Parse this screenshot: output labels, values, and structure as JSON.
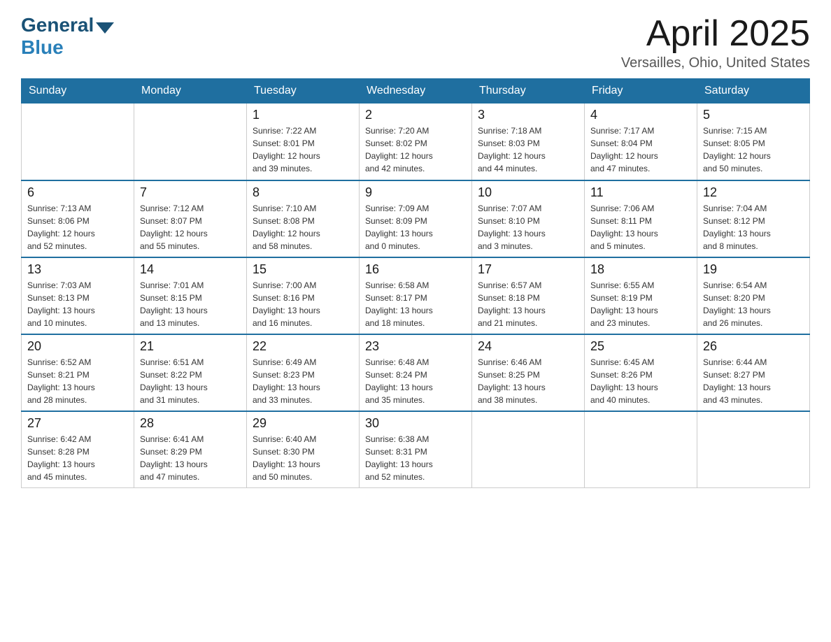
{
  "header": {
    "logo": {
      "general": "General",
      "triangle_symbol": "▶",
      "blue": "Blue"
    },
    "title": "April 2025",
    "location": "Versailles, Ohio, United States"
  },
  "calendar": {
    "days_of_week": [
      "Sunday",
      "Monday",
      "Tuesday",
      "Wednesday",
      "Thursday",
      "Friday",
      "Saturday"
    ],
    "weeks": [
      [
        {
          "day": "",
          "info": ""
        },
        {
          "day": "",
          "info": ""
        },
        {
          "day": "1",
          "info": "Sunrise: 7:22 AM\nSunset: 8:01 PM\nDaylight: 12 hours\nand 39 minutes."
        },
        {
          "day": "2",
          "info": "Sunrise: 7:20 AM\nSunset: 8:02 PM\nDaylight: 12 hours\nand 42 minutes."
        },
        {
          "day": "3",
          "info": "Sunrise: 7:18 AM\nSunset: 8:03 PM\nDaylight: 12 hours\nand 44 minutes."
        },
        {
          "day": "4",
          "info": "Sunrise: 7:17 AM\nSunset: 8:04 PM\nDaylight: 12 hours\nand 47 minutes."
        },
        {
          "day": "5",
          "info": "Sunrise: 7:15 AM\nSunset: 8:05 PM\nDaylight: 12 hours\nand 50 minutes."
        }
      ],
      [
        {
          "day": "6",
          "info": "Sunrise: 7:13 AM\nSunset: 8:06 PM\nDaylight: 12 hours\nand 52 minutes."
        },
        {
          "day": "7",
          "info": "Sunrise: 7:12 AM\nSunset: 8:07 PM\nDaylight: 12 hours\nand 55 minutes."
        },
        {
          "day": "8",
          "info": "Sunrise: 7:10 AM\nSunset: 8:08 PM\nDaylight: 12 hours\nand 58 minutes."
        },
        {
          "day": "9",
          "info": "Sunrise: 7:09 AM\nSunset: 8:09 PM\nDaylight: 13 hours\nand 0 minutes."
        },
        {
          "day": "10",
          "info": "Sunrise: 7:07 AM\nSunset: 8:10 PM\nDaylight: 13 hours\nand 3 minutes."
        },
        {
          "day": "11",
          "info": "Sunrise: 7:06 AM\nSunset: 8:11 PM\nDaylight: 13 hours\nand 5 minutes."
        },
        {
          "day": "12",
          "info": "Sunrise: 7:04 AM\nSunset: 8:12 PM\nDaylight: 13 hours\nand 8 minutes."
        }
      ],
      [
        {
          "day": "13",
          "info": "Sunrise: 7:03 AM\nSunset: 8:13 PM\nDaylight: 13 hours\nand 10 minutes."
        },
        {
          "day": "14",
          "info": "Sunrise: 7:01 AM\nSunset: 8:15 PM\nDaylight: 13 hours\nand 13 minutes."
        },
        {
          "day": "15",
          "info": "Sunrise: 7:00 AM\nSunset: 8:16 PM\nDaylight: 13 hours\nand 16 minutes."
        },
        {
          "day": "16",
          "info": "Sunrise: 6:58 AM\nSunset: 8:17 PM\nDaylight: 13 hours\nand 18 minutes."
        },
        {
          "day": "17",
          "info": "Sunrise: 6:57 AM\nSunset: 8:18 PM\nDaylight: 13 hours\nand 21 minutes."
        },
        {
          "day": "18",
          "info": "Sunrise: 6:55 AM\nSunset: 8:19 PM\nDaylight: 13 hours\nand 23 minutes."
        },
        {
          "day": "19",
          "info": "Sunrise: 6:54 AM\nSunset: 8:20 PM\nDaylight: 13 hours\nand 26 minutes."
        }
      ],
      [
        {
          "day": "20",
          "info": "Sunrise: 6:52 AM\nSunset: 8:21 PM\nDaylight: 13 hours\nand 28 minutes."
        },
        {
          "day": "21",
          "info": "Sunrise: 6:51 AM\nSunset: 8:22 PM\nDaylight: 13 hours\nand 31 minutes."
        },
        {
          "day": "22",
          "info": "Sunrise: 6:49 AM\nSunset: 8:23 PM\nDaylight: 13 hours\nand 33 minutes."
        },
        {
          "day": "23",
          "info": "Sunrise: 6:48 AM\nSunset: 8:24 PM\nDaylight: 13 hours\nand 35 minutes."
        },
        {
          "day": "24",
          "info": "Sunrise: 6:46 AM\nSunset: 8:25 PM\nDaylight: 13 hours\nand 38 minutes."
        },
        {
          "day": "25",
          "info": "Sunrise: 6:45 AM\nSunset: 8:26 PM\nDaylight: 13 hours\nand 40 minutes."
        },
        {
          "day": "26",
          "info": "Sunrise: 6:44 AM\nSunset: 8:27 PM\nDaylight: 13 hours\nand 43 minutes."
        }
      ],
      [
        {
          "day": "27",
          "info": "Sunrise: 6:42 AM\nSunset: 8:28 PM\nDaylight: 13 hours\nand 45 minutes."
        },
        {
          "day": "28",
          "info": "Sunrise: 6:41 AM\nSunset: 8:29 PM\nDaylight: 13 hours\nand 47 minutes."
        },
        {
          "day": "29",
          "info": "Sunrise: 6:40 AM\nSunset: 8:30 PM\nDaylight: 13 hours\nand 50 minutes."
        },
        {
          "day": "30",
          "info": "Sunrise: 6:38 AM\nSunset: 8:31 PM\nDaylight: 13 hours\nand 52 minutes."
        },
        {
          "day": "",
          "info": ""
        },
        {
          "day": "",
          "info": ""
        },
        {
          "day": "",
          "info": ""
        }
      ]
    ]
  }
}
